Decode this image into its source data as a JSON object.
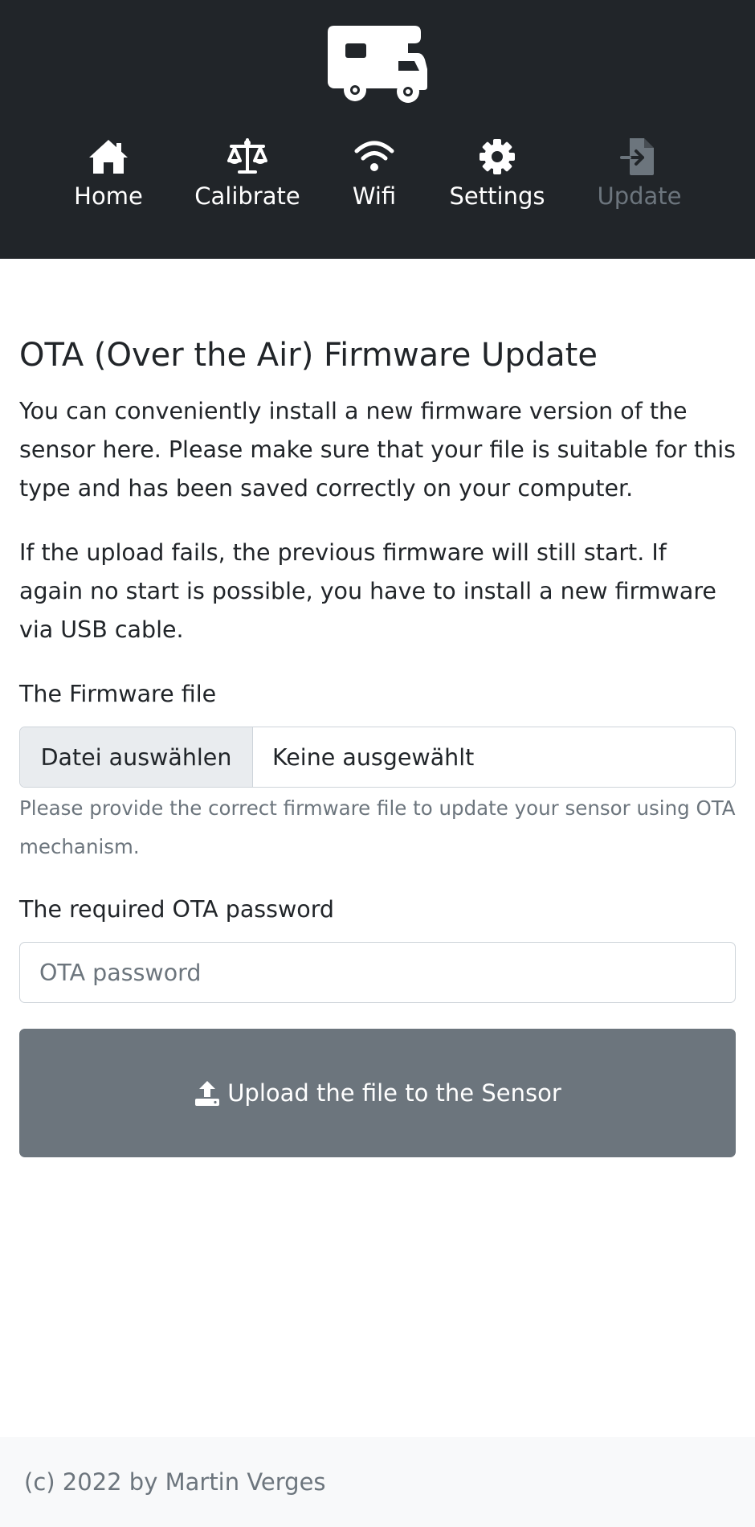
{
  "header": {
    "logo_icon": "camper-van-icon",
    "nav": [
      {
        "label": "Home",
        "icon": "home-icon",
        "active": false
      },
      {
        "label": "Calibrate",
        "icon": "scale-balanced-icon",
        "active": false
      },
      {
        "label": "Wifi",
        "icon": "wifi-icon",
        "active": false
      },
      {
        "label": "Settings",
        "icon": "gear-icon",
        "active": false
      },
      {
        "label": "Update",
        "icon": "file-import-icon",
        "active": true
      }
    ]
  },
  "main": {
    "title": "OTA (Over the Air) Firmware Update",
    "paragraph1": "You can conveniently install a new firmware version of the sensor here. Please make sure that your file is suitable for this type and has been saved correctly on your computer.",
    "paragraph2": "If the upload fails, the previous firmware will still start. If again no start is possible, you have to install a new firmware via USB cable.",
    "firmware": {
      "label": "The Firmware file",
      "button_label": "Datei auswählen",
      "file_status": "Keine ausgewählt",
      "help": "Please provide the correct firmware file to update your sensor using OTA mechanism."
    },
    "password": {
      "label": "The required OTA password",
      "placeholder": "OTA password",
      "value": ""
    },
    "upload_button": {
      "label": "Upload the file to the Sensor",
      "icon": "upload-icon"
    }
  },
  "footer": {
    "text": "(c) 2022 by Martin Verges"
  },
  "colors": {
    "header_bg": "#212529",
    "nav_active": "#6c757d",
    "button_bg": "#6c757d",
    "footer_bg": "#f8f9fa",
    "muted_text": "#6c757d"
  }
}
